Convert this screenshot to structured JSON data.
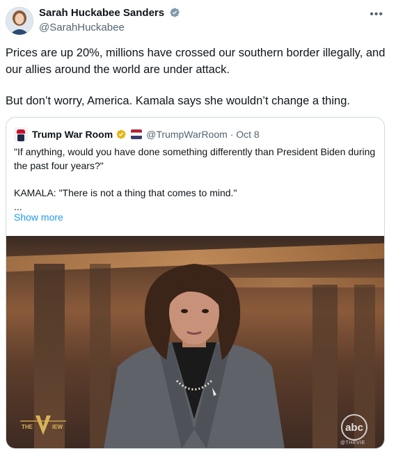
{
  "author": {
    "name": "Sarah Huckabee Sanders",
    "handle": "@SarahHuckabee",
    "verified_icon": "verified-badge-icon",
    "badge_color": "#829aab"
  },
  "tweet": {
    "paragraph1": "Prices are up 20%, millions have crossed our southern border illegally, and our allies around the world are under attack.",
    "paragraph2": "But don’t worry, America. Kamala says she wouldn’t change a thing."
  },
  "quoted": {
    "name": "Trump War Room",
    "handle": "@TrumpWarRoom",
    "date": "· Oct 8",
    "badge_color": "#e2b719",
    "line1": "\"If anything, would you have done something differently than President Biden during the past four years?\"",
    "line2": "KAMALA: \"There is not a thing that comes to mind.\"",
    "line3": "...",
    "show_more": "Show more"
  },
  "video": {
    "logo_left": "THE VIEW",
    "logo_right": "abc",
    "logo_caption": "@THEVIE"
  },
  "menu_icon": "more-options-icon",
  "link_color": "#1d9bf0"
}
